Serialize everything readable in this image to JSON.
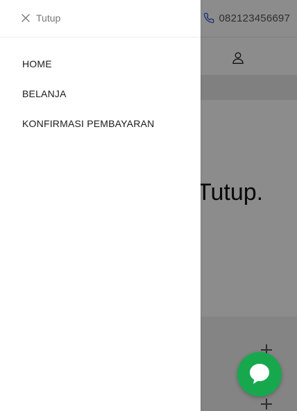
{
  "topbar": {
    "phone_number": "082123456697"
  },
  "hero": {
    "text": "Tutup."
  },
  "drawer": {
    "close_label": "Tutup",
    "menu": [
      {
        "label": "HOME"
      },
      {
        "label": "BELANJA"
      },
      {
        "label": "KONFIRMASI PEMBAYARAN"
      }
    ]
  },
  "icons": {
    "close": "close-icon",
    "phone": "phone-icon",
    "user": "user-icon",
    "chat": "chat-icon",
    "plus": "plus-icon"
  },
  "colors": {
    "phone_icon": "#3a5cd6",
    "chat_button": "#17a84e",
    "overlay": "rgba(0,0,0,0.45)"
  }
}
